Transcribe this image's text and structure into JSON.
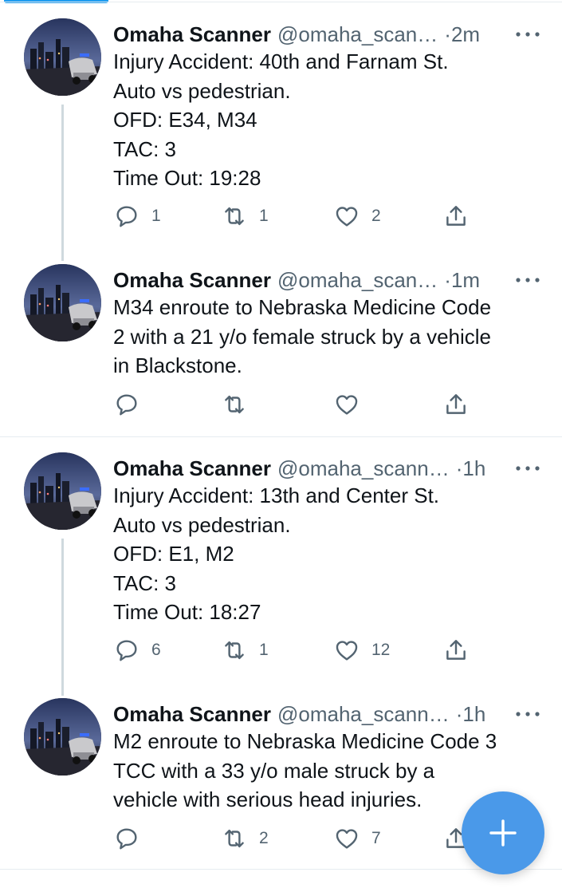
{
  "colors": {
    "accent": "#1d9bf0",
    "fab": "#4a99e9",
    "text_primary": "#0f1419",
    "text_secondary": "#536471",
    "divider": "#e6ecf0",
    "thread_line": "#cfd9de"
  },
  "fab": {
    "icon": "plus-icon"
  },
  "tweets": [
    {
      "name": "Omaha Scanner",
      "handle": "@omaha_scan…",
      "dot": "·",
      "time": "2m",
      "lines": [
        "Injury Accident: 40th and Farnam St.",
        "Auto vs pedestrian.",
        "OFD: E34, M34",
        "TAC: 3",
        "Time Out: 19:28"
      ],
      "replies": "1",
      "retweets": "1",
      "likes": "2"
    },
    {
      "name": "Omaha Scanner",
      "handle": "@omaha_scan…",
      "dot": "·",
      "time": "1m",
      "lines": [
        "M34 enroute to Nebraska Medicine Code",
        "2 with a 21 y/o female struck by a vehicle",
        "in Blackstone."
      ],
      "replies": "",
      "retweets": "",
      "likes": ""
    },
    {
      "name": "Omaha Scanner",
      "handle": "@omaha_scann…",
      "dot": "·",
      "time": "1h",
      "lines": [
        "Injury Accident: 13th and Center St.",
        "Auto vs pedestrian.",
        "OFD: E1, M2",
        "TAC: 3",
        "Time Out: 18:27"
      ],
      "replies": "6",
      "retweets": "1",
      "likes": "12"
    },
    {
      "name": "Omaha Scanner",
      "handle": "@omaha_scann…",
      "dot": "·",
      "time": "1h",
      "lines": [
        "M2 enroute to Nebraska Medicine Code 3",
        "TCC with a 33 y/o male struck by a",
        "vehicle with serious head injuries."
      ],
      "replies": "",
      "retweets": "2",
      "likes": "7"
    }
  ]
}
